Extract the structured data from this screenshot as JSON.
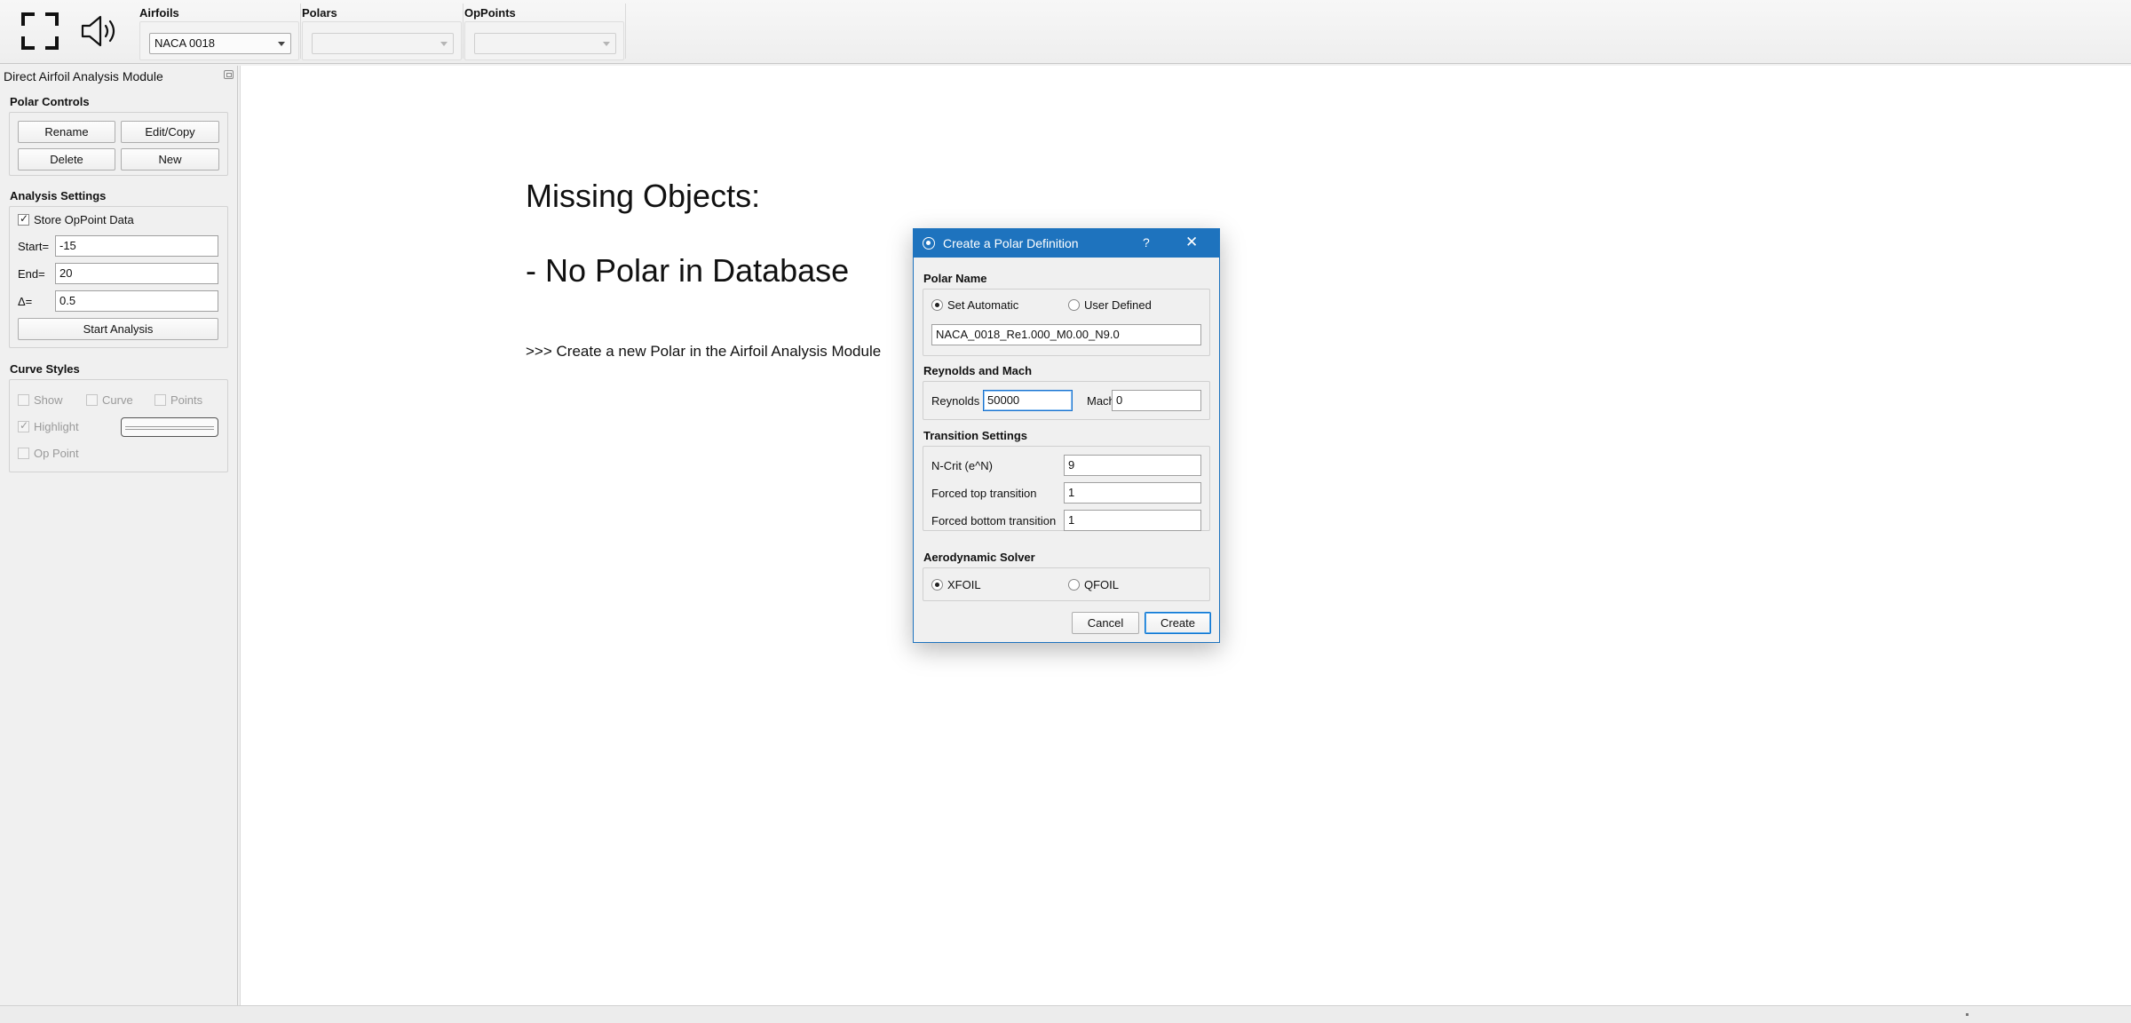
{
  "toolbar": {
    "fullscreen_icon": "fullscreen-icon",
    "sound_icon": "speaker-icon",
    "airfoils": {
      "label": "Airfoils",
      "selected": "NACA 0018"
    },
    "polars": {
      "label": "Polars",
      "selected": ""
    },
    "opoints": {
      "label": "OpPoints",
      "selected": ""
    }
  },
  "dock": {
    "title": "Direct Airfoil Analysis Module",
    "polar_controls": {
      "title": "Polar Controls",
      "rename": "Rename",
      "edit_copy": "Edit/Copy",
      "delete": "Delete",
      "new": "New"
    },
    "analysis_settings": {
      "title": "Analysis Settings",
      "store_opoint_label": "Store OpPoint Data",
      "store_opoint_checked": true,
      "start_label": "Start=",
      "start_value": "-15",
      "end_label": "End=",
      "end_value": "20",
      "delta_label": "Δ=",
      "delta_value": "0.5",
      "start_analysis": "Start Analysis"
    },
    "curve_styles": {
      "title": "Curve Styles",
      "show": "Show",
      "curve": "Curve",
      "points": "Points",
      "highlight": "Highlight",
      "highlight_checked": true,
      "op_point": "Op Point"
    }
  },
  "viewport": {
    "missing_title": "Missing Objects:",
    "missing_sub": "- No Polar in Database",
    "hint": ">>> Create a new Polar in the Airfoil Analysis Module"
  },
  "dialog": {
    "title": "Create a Polar Definition",
    "help": "?",
    "close": "✕",
    "polar_name": {
      "title": "Polar Name",
      "set_automatic": "Set Automatic",
      "user_defined": "User Defined",
      "selected": "Set Automatic",
      "name_value": "NACA_0018_Re1.000_M0.00_N9.0"
    },
    "reynolds_mach": {
      "title": "Reynolds and Mach",
      "reynolds_label": "Reynolds",
      "reynolds_value": "50000",
      "mach_label": "Mach",
      "mach_value": "0"
    },
    "transition": {
      "title": "Transition Settings",
      "ncrit_label": "N-Crit (e^N)",
      "ncrit_value": "9",
      "top_label": "Forced top transition",
      "top_value": "1",
      "bottom_label": "Forced bottom transition",
      "bottom_value": "1"
    },
    "solver": {
      "title": "Aerodynamic Solver",
      "xfoil": "XFOIL",
      "qfoil": "QFOIL",
      "selected": "XFOIL"
    },
    "cancel": "Cancel",
    "create": "Create"
  }
}
